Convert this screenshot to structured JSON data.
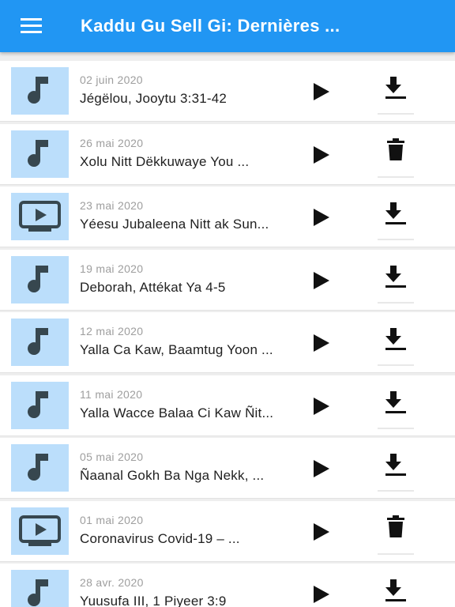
{
  "appbar": {
    "title": "Kaddu Gu Sell Gi: Dernières ...",
    "menu_icon": "menu-icon",
    "color": "#2196f3"
  },
  "thumb_color": "#bbdefb",
  "items": [
    {
      "date": "02 juin 2020",
      "title": "Jégëlou, Jooytu 3:31-42",
      "media": "audio",
      "action": "download"
    },
    {
      "date": "26 mai 2020",
      "title": "Xolu Nitt Dëkkuwaye You ...",
      "media": "audio",
      "action": "delete"
    },
    {
      "date": "23 mai 2020",
      "title": "Yéesu Jubaleena Nitt ak Sun...",
      "media": "video",
      "action": "download"
    },
    {
      "date": "19 mai 2020",
      "title": "Deborah, Attékat Ya 4-5",
      "media": "audio",
      "action": "download"
    },
    {
      "date": "12 mai 2020",
      "title": "Yalla Ca Kaw, Baamtug Yoon ...",
      "media": "audio",
      "action": "download"
    },
    {
      "date": "11 mai 2020",
      "title": "Yalla Wacce Balaa Ci Kaw Ñit...",
      "media": "audio",
      "action": "download"
    },
    {
      "date": "05 mai 2020",
      "title": "Ñaanal Gokh Ba Nga Nekk, ...",
      "media": "audio",
      "action": "download"
    },
    {
      "date": "01 mai 2020",
      "title": "Coronavirus Covid-19 – ...",
      "media": "video",
      "action": "delete"
    },
    {
      "date": "28 avr. 2020",
      "title": "Yuusufa III, 1 Piyeer 3:9",
      "media": "audio",
      "action": "download"
    }
  ]
}
